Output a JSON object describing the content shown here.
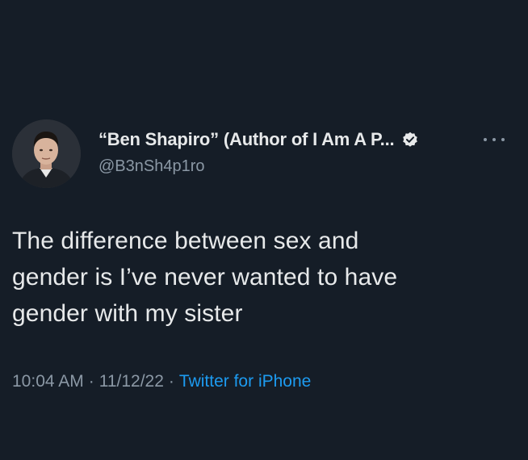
{
  "tweet": {
    "display_name": "“Ben Shapiro” (Author of I Am A P...",
    "handle": "@B3nSh4p1ro",
    "verified_icon": "verified-badge-icon",
    "more_icon": "more-options-icon",
    "text_lines": [
      "The difference between sex and",
      "gender is I’ve never wanted to have",
      "gender with my sister"
    ],
    "time": "10:04 AM",
    "separator": "·",
    "date": "11/12/22",
    "source": "Twitter for iPhone"
  },
  "colors": {
    "background": "#151d27",
    "primary_text": "#e7e9ea",
    "secondary_text": "#8b98a5",
    "link": "#1d9bf0"
  }
}
